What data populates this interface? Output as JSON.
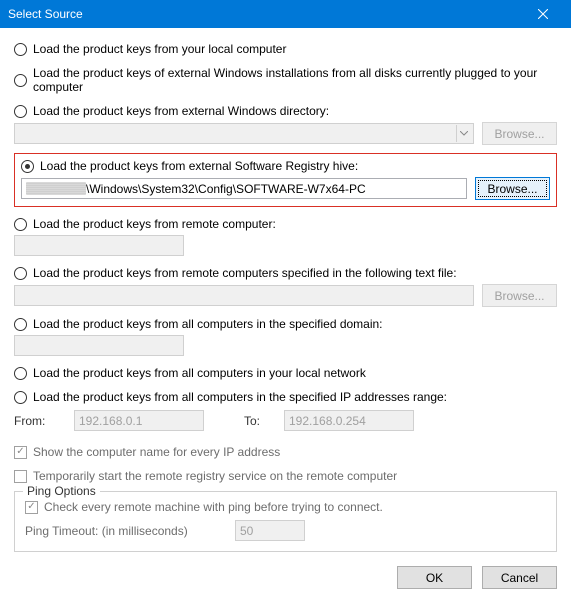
{
  "window": {
    "title": "Select Source"
  },
  "options": {
    "local": "Load the product keys from your local computer",
    "ext_installs": "Load the product keys of external Windows installations from all disks currently plugged to your computer",
    "ext_dir": "Load the product keys from external Windows directory:",
    "ext_hive": "Load the product keys from external Software Registry hive:",
    "remote": "Load the product keys from remote computer:",
    "remote_file": "Load the product keys from remote computers specified in the following text file:",
    "domain": "Load the product keys from all computers in the specified domain:",
    "local_net": "Load the product keys from all computers in your local network",
    "ip_range": "Load the product keys from all computers in the specified IP addresses range:"
  },
  "fields": {
    "hive_path": "\\Windows\\System32\\Config\\SOFTWARE-W7x64-PC",
    "from_label": "From:",
    "to_label": "To:",
    "ip_from": "192.168.0.1",
    "ip_to": "192.168.0.254"
  },
  "checks": {
    "show_name": "Show the computer name for every IP address",
    "temp_registry": "Temporarily start the remote registry service on the remote computer"
  },
  "ping": {
    "legend": "Ping Options",
    "check": "Check every remote machine with ping before trying to connect.",
    "timeout_label": "Ping Timeout: (in milliseconds)",
    "timeout_value": "50"
  },
  "buttons": {
    "browse": "Browse...",
    "ok": "OK",
    "cancel": "Cancel"
  }
}
